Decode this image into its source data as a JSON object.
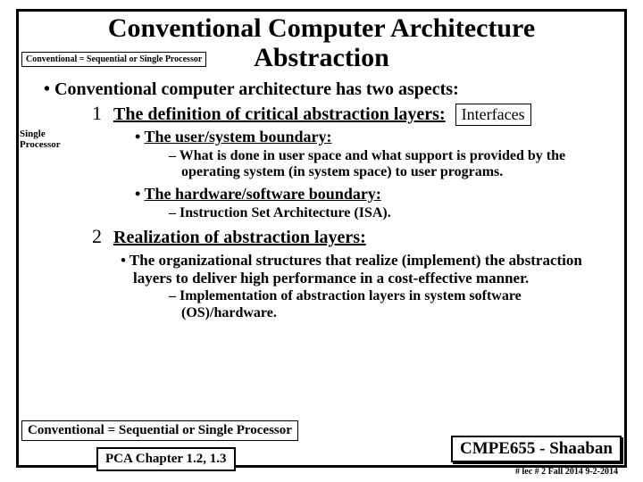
{
  "title_line1": "Conventional Computer Architecture",
  "title_line2": "Abstraction",
  "annot_top": "Conventional = Sequential or Single Processor",
  "annot_left_l1": "Single",
  "annot_left_l2": "Processor",
  "bullets": {
    "intro": "•  Conventional computer architecture has two aspects:",
    "num1": "1",
    "def1": "The definition of critical abstraction layers:",
    "interfaces": "Interfaces",
    "b2a": "The user/system boundary:",
    "b3a": "What is done in user space and what support is provided by the operating system (in system space) to user programs.",
    "b2b": "The hardware/software boundary:",
    "b3b": "Instruction Set Architecture (ISA).",
    "num2": "2",
    "def2": "Realization of abstraction layers:",
    "b2c": "The organizational structures that realize (implement) the abstraction layers to deliver high performance in a cost-effective manner.",
    "b3c": "Implementation of abstraction layers in system software (OS)/hardware."
  },
  "bottom_left": "Conventional = Sequential or Single Processor",
  "pca": "PCA Chapter 1.2, 1.3",
  "course": "CMPE655 - Shaaban",
  "footer": "#  lec # 2   Fall 2014  9-2-2014"
}
